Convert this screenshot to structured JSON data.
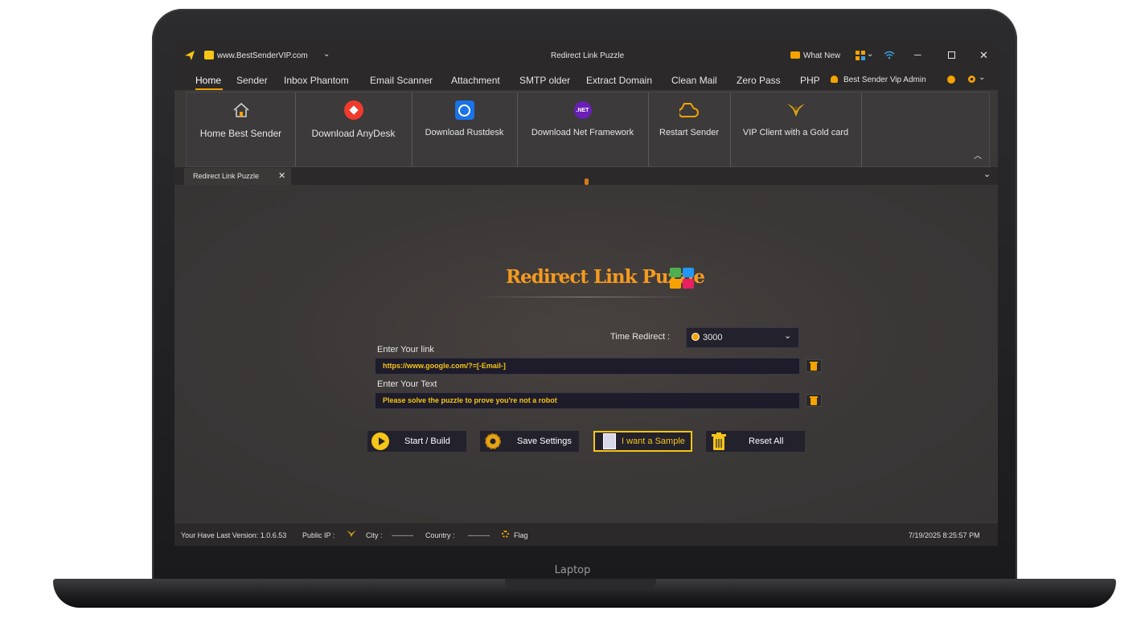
{
  "device": {
    "brand": "Laptop"
  },
  "window": {
    "url": "www.BestSenderVIP.com",
    "title": "Redirect Link Puzzle",
    "whats_new": "What New",
    "colors": {
      "accent": "#f5a300",
      "field_text": "#f5c518",
      "title_text": "#f59a1e"
    }
  },
  "menu": {
    "items": [
      {
        "label": "Home",
        "active": true
      },
      {
        "label": "Sender"
      },
      {
        "label": "Inbox Phantom"
      },
      {
        "label": "Email Scanner"
      },
      {
        "label": "Attachment"
      },
      {
        "label": "SMTP older"
      },
      {
        "label": "Extract Domain"
      },
      {
        "label": "Clean Mail"
      },
      {
        "label": "Zero Pass"
      },
      {
        "label": "PHP"
      }
    ],
    "user": "Best Sender Vip Admin"
  },
  "ribbon": {
    "buttons": [
      {
        "label": "Home Best Sender",
        "icon": "home-icon"
      },
      {
        "label": "Download AnyDesk",
        "icon": "anydesk-icon"
      },
      {
        "label": "Download Rustdesk",
        "icon": "rustdesk-icon"
      },
      {
        "label": "Download Net Framework",
        "icon": "dotnet-icon"
      },
      {
        "label": "Restart Sender",
        "icon": "restart-icon"
      },
      {
        "label": "VIP Client with a Gold card",
        "icon": "gold-eagle-icon"
      }
    ],
    "dotnet_badge": ".NET"
  },
  "tabs": [
    {
      "label": "Redirect Link Puzzle"
    }
  ],
  "main": {
    "title": "Redirect Link Puzzle",
    "time_redirect_label": "Time Redirect :",
    "time_redirect_value": "3000",
    "link_label": "Enter Your link",
    "link_value": "https://www.google.com/?=[-Email-]",
    "text_label": "Enter Your Text",
    "text_value": "Please solve the puzzle to prove you're not a robot",
    "buttons": {
      "start": "Start / Build",
      "save": "Save Settings",
      "sample": "I want a Sample",
      "reset": "Reset All"
    }
  },
  "status": {
    "version": "Your Have Last Version: 1.0.6.53",
    "public_ip_label": "Public IP :",
    "city_label": "City :",
    "city_value": "---------",
    "country_label": "Country :",
    "country_value": "---------",
    "flag_label": "Flag",
    "datetime": "7/19/2025 8:25:57 PM"
  }
}
